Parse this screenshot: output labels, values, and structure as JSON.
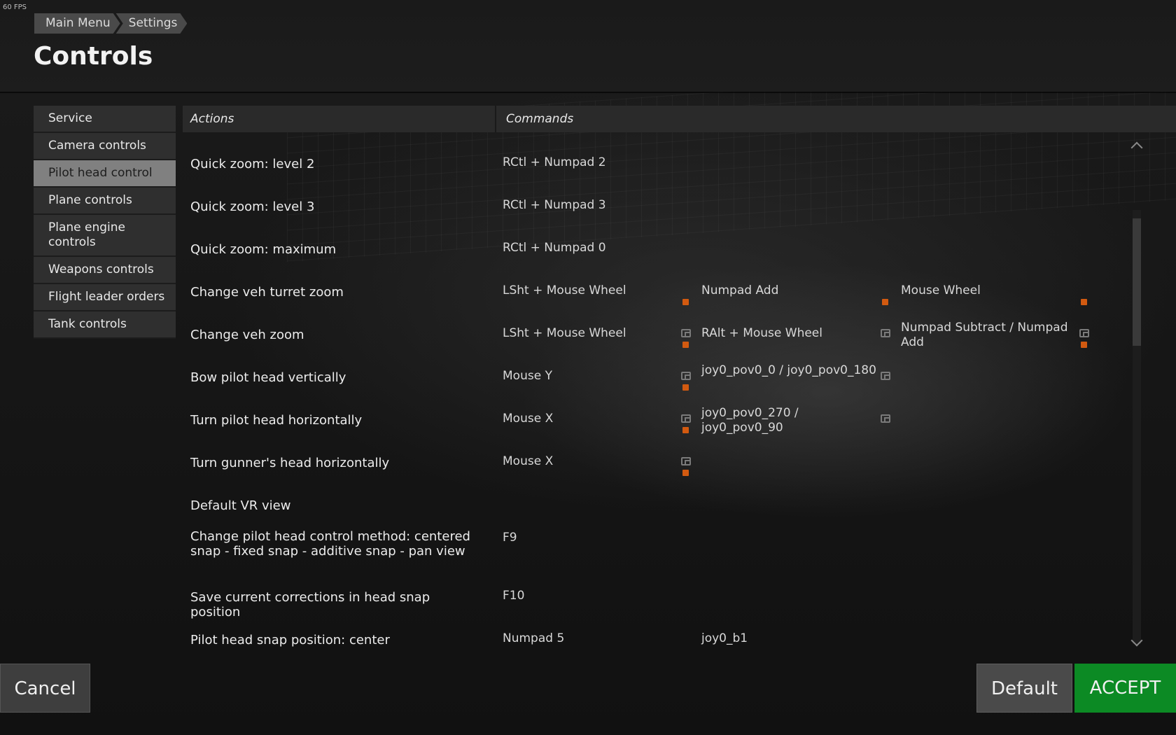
{
  "fps": "60 FPS",
  "breadcrumb": [
    "Main Menu",
    "Settings"
  ],
  "title": "Controls",
  "sidebar": {
    "items": [
      {
        "label": "Service"
      },
      {
        "label": "Camera controls"
      },
      {
        "label": "Pilot head control",
        "active": true
      },
      {
        "label": "Plane controls"
      },
      {
        "label": "Plane engine controls"
      },
      {
        "label": "Weapons controls"
      },
      {
        "label": "Flight leader orders"
      },
      {
        "label": "Tank controls"
      }
    ]
  },
  "table": {
    "headers": {
      "actions": "Actions",
      "commands": "Commands"
    },
    "rows": [
      {
        "action": "Quick zoom: level 2",
        "commands": [
          "RCtl + Numpad 2",
          "",
          ""
        ]
      },
      {
        "action": "Quick zoom: level 3",
        "commands": [
          "RCtl + Numpad 3",
          "",
          ""
        ]
      },
      {
        "action": "Quick zoom: maximum",
        "commands": [
          "RCtl + Numpad 0",
          "",
          ""
        ]
      },
      {
        "action": "Change veh turret zoom",
        "commands": [
          "LSht + Mouse Wheel",
          "Numpad Add",
          "Mouse Wheel"
        ]
      },
      {
        "action": "Change veh zoom",
        "commands": [
          "LSht + Mouse Wheel",
          "RAlt + Mouse Wheel",
          "Numpad Subtract / Numpad Add"
        ]
      },
      {
        "action": "Bow pilot head vertically",
        "commands": [
          "Mouse Y",
          "joy0_pov0_0 / joy0_pov0_180",
          ""
        ]
      },
      {
        "action": "Turn pilot head horizontally",
        "commands": [
          "Mouse X",
          "joy0_pov0_270 / joy0_pov0_90",
          ""
        ]
      },
      {
        "action": "Turn gunner's head horizontally",
        "commands": [
          "Mouse X",
          "",
          ""
        ]
      },
      {
        "action": "Default VR view",
        "commands": [
          "",
          "",
          ""
        ]
      },
      {
        "action": "Change pilot head control method: centered snap - fixed snap - additive snap - pan view",
        "commands": [
          "F9",
          "",
          ""
        ]
      },
      {
        "action": "Save current corrections in head snap position",
        "commands": [
          "F10",
          "",
          ""
        ]
      },
      {
        "action": "Pilot head snap position: center",
        "commands": [
          "Numpad 5",
          "joy0_b1",
          ""
        ]
      }
    ]
  },
  "buttons": {
    "cancel": "Cancel",
    "default": "Default",
    "accept": "ACCEPT"
  },
  "colors": {
    "accept": "#0c8a24",
    "bind_marker": "#d25a10",
    "active_tab": "#808080"
  }
}
